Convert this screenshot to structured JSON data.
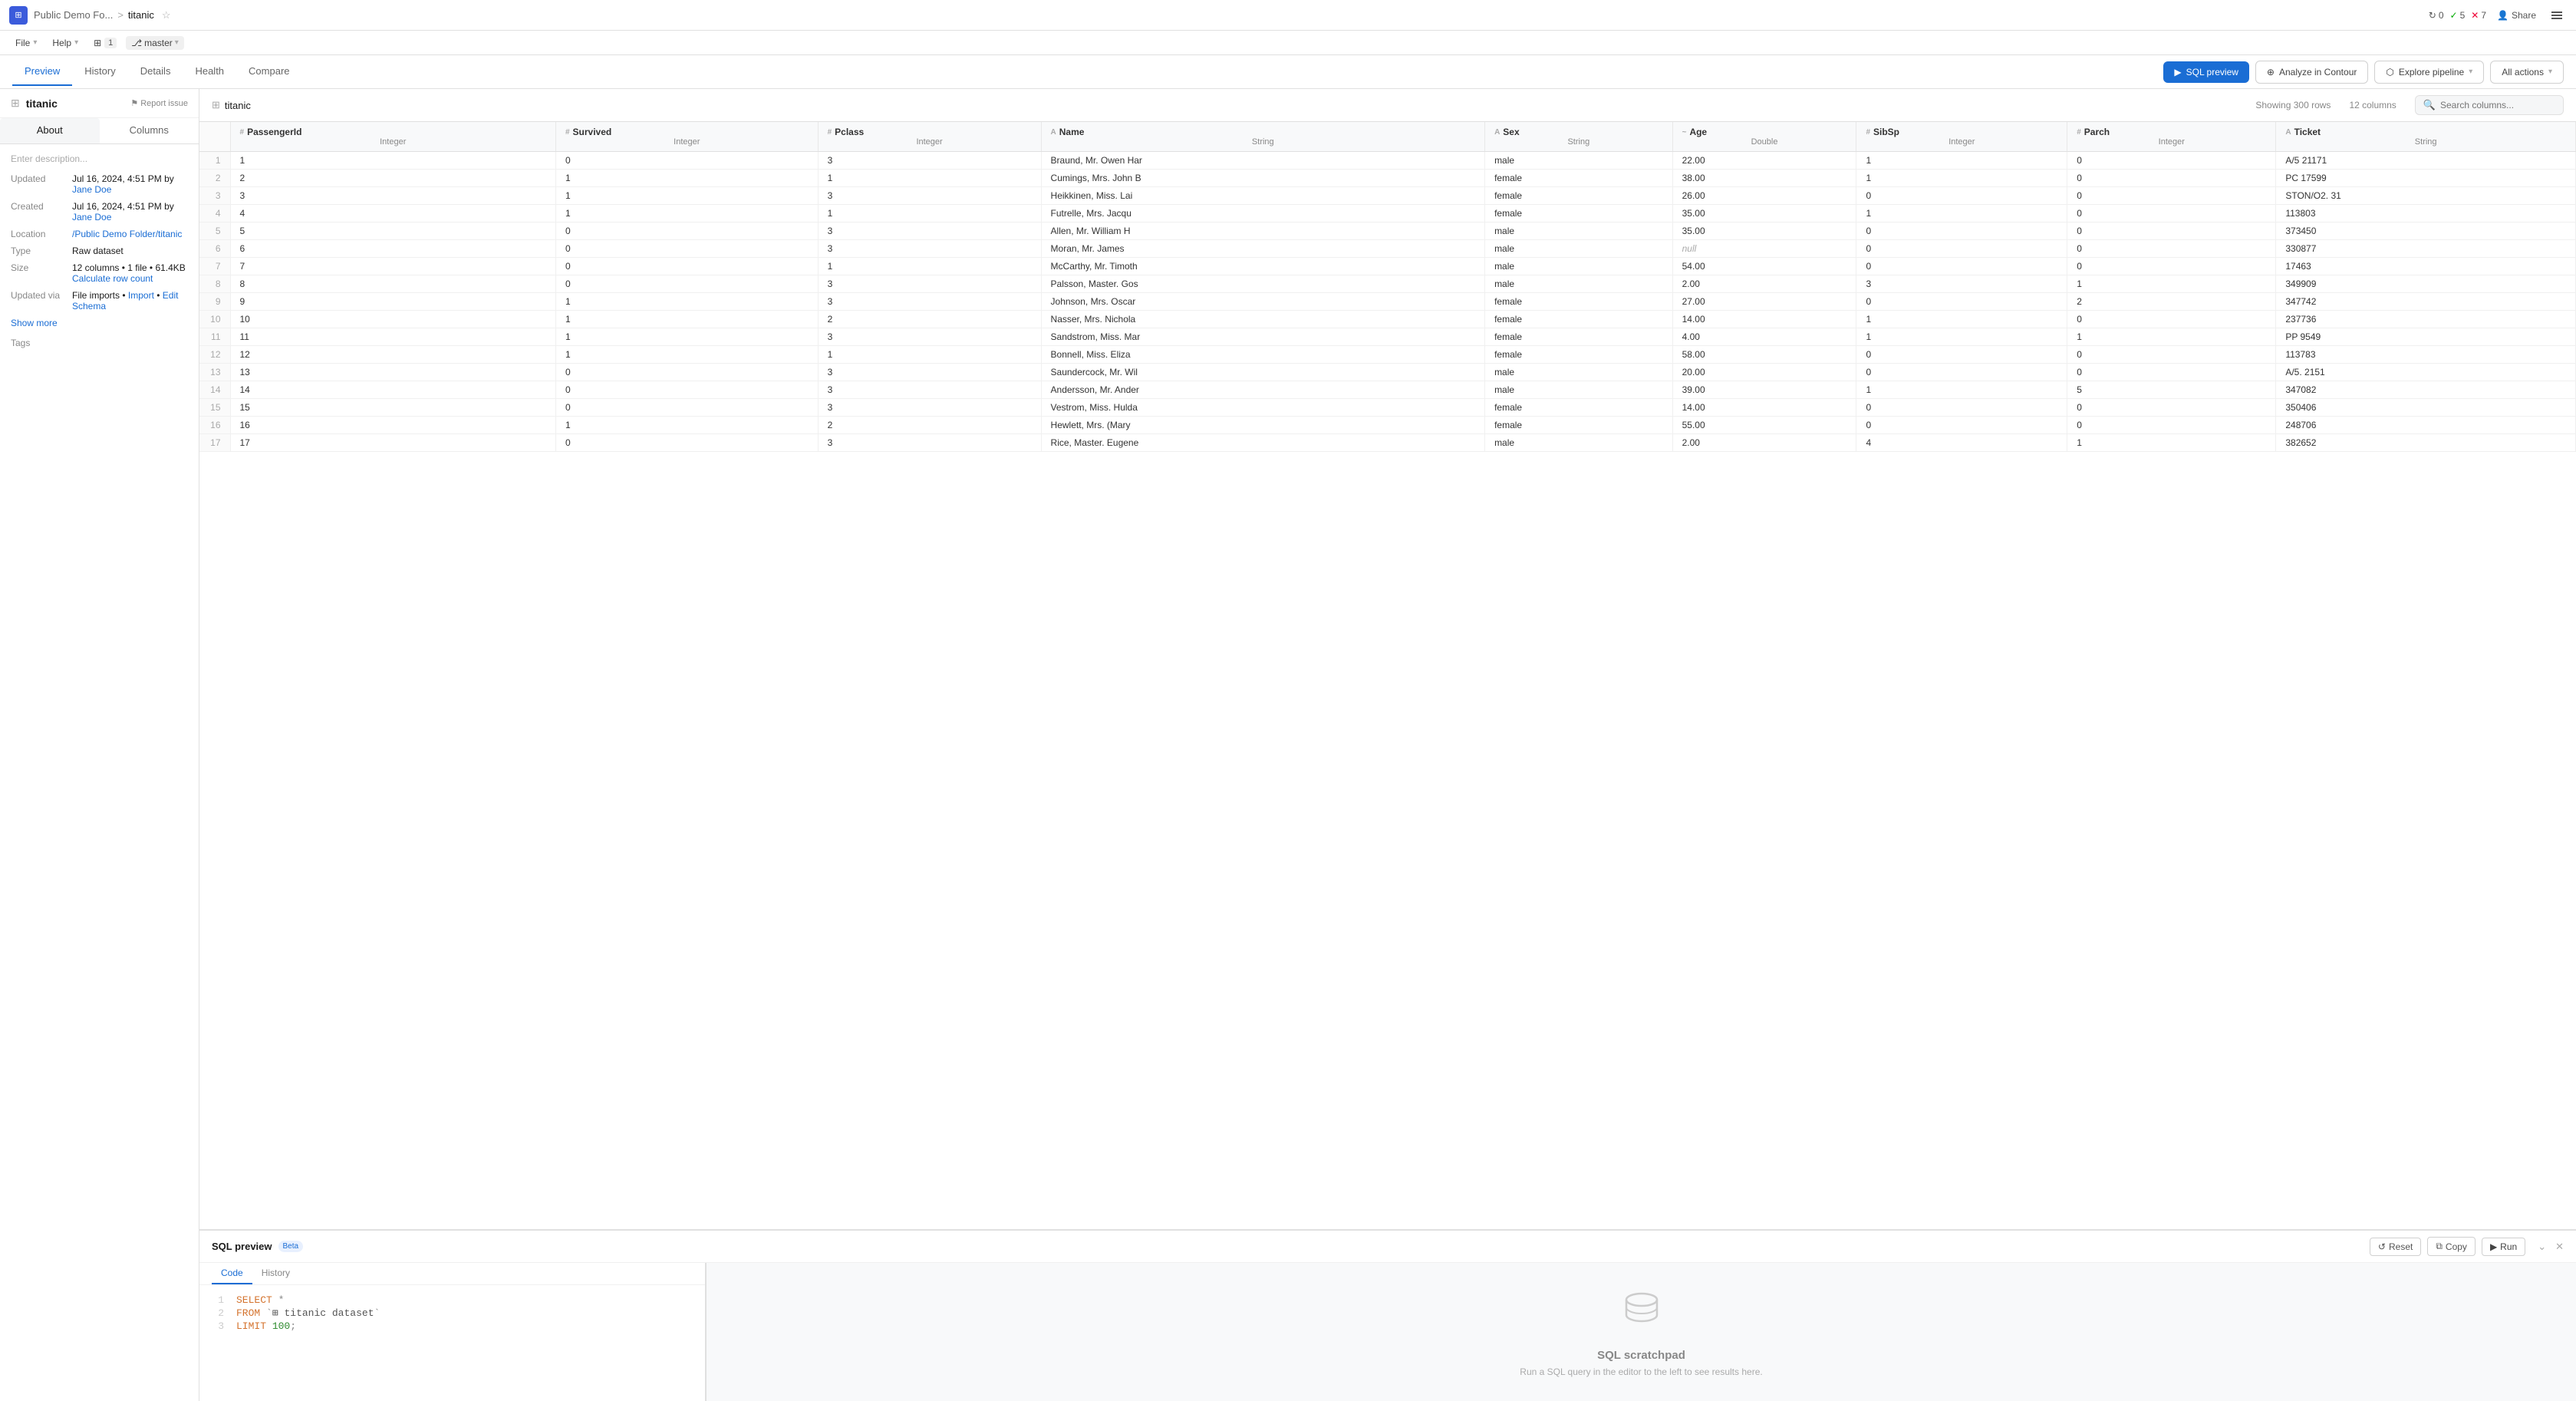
{
  "topbar": {
    "app_icon": "⊞",
    "breadcrumb_parent": "Public Demo Fo...",
    "breadcrumb_sep": ">",
    "breadcrumb_current": "titanic",
    "share_label": "Share",
    "status": {
      "sync_count": "0",
      "check_count": "5",
      "error_count": "7"
    }
  },
  "filemenu": {
    "file_label": "File",
    "help_label": "Help",
    "pages_label": "1",
    "branch_label": "master"
  },
  "tabs": {
    "items": [
      "Preview",
      "History",
      "Details",
      "Health",
      "Compare"
    ],
    "active": "Preview"
  },
  "toolbar": {
    "sql_preview_label": "SQL preview",
    "analyze_label": "Analyze in Contour",
    "explore_label": "Explore pipeline",
    "all_actions_label": "All actions"
  },
  "left_panel": {
    "dataset_name": "titanic",
    "report_issue_label": "Report issue",
    "panel_tabs": [
      "About",
      "Columns"
    ],
    "active_panel_tab": "About",
    "description_placeholder": "Enter description...",
    "meta": {
      "updated_label": "Updated",
      "updated_value": "Jul 16, 2024, 4:51 PM by",
      "updated_user": "Jane Doe",
      "created_label": "Created",
      "created_value": "Jul 16, 2024, 4:51 PM by",
      "created_user": "Jane Doe",
      "location_label": "Location",
      "location_value": "/Public Demo Folder/titanic",
      "type_label": "Type",
      "type_value": "Raw dataset",
      "size_label": "Size",
      "size_value": "12 columns • 1 file • 61.4KB",
      "calculate_label": "Calculate row count",
      "updated_via_label": "Updated via",
      "updated_via_value": "File imports •",
      "import_label": "Import",
      "edit_schema_label": "Edit Schema"
    },
    "show_more_label": "Show more",
    "tags_label": "Tags"
  },
  "data_table": {
    "table_name": "titanic",
    "showing_rows": "Showing 300 rows",
    "columns_count": "12 columns",
    "search_placeholder": "Search columns...",
    "columns": [
      {
        "name": "PassengerId",
        "type": "Integer"
      },
      {
        "name": "Survived",
        "type": "Integer"
      },
      {
        "name": "Pclass",
        "type": "Integer"
      },
      {
        "name": "Name",
        "type": "String"
      },
      {
        "name": "Sex",
        "type": "String"
      },
      {
        "name": "Age",
        "type": "Double"
      },
      {
        "name": "SibSp",
        "type": "Integer"
      },
      {
        "name": "Parch",
        "type": "Integer"
      },
      {
        "name": "Ticket",
        "type": "String"
      }
    ],
    "rows": [
      [
        1,
        0,
        3,
        "Braund, Mr. Owen Har",
        "male",
        "22.00",
        1,
        0,
        "A/5 21171"
      ],
      [
        2,
        1,
        1,
        "Cumings, Mrs. John B",
        "female",
        "38.00",
        1,
        0,
        "PC 17599"
      ],
      [
        3,
        1,
        3,
        "Heikkinen, Miss. Lai",
        "female",
        "26.00",
        0,
        0,
        "STON/O2. 31"
      ],
      [
        4,
        1,
        1,
        "Futrelle, Mrs. Jacqu",
        "female",
        "35.00",
        1,
        0,
        "113803"
      ],
      [
        5,
        0,
        3,
        "Allen, Mr. William H",
        "male",
        "35.00",
        0,
        0,
        "373450"
      ],
      [
        6,
        0,
        3,
        "Moran, Mr. James",
        "male",
        null,
        0,
        0,
        "330877"
      ],
      [
        7,
        0,
        1,
        "McCarthy, Mr. Timoth",
        "male",
        "54.00",
        0,
        0,
        "17463"
      ],
      [
        8,
        0,
        3,
        "Palsson, Master. Gos",
        "male",
        "2.00",
        3,
        1,
        "349909"
      ],
      [
        9,
        1,
        3,
        "Johnson, Mrs. Oscar ",
        "female",
        "27.00",
        0,
        2,
        "347742"
      ],
      [
        10,
        1,
        2,
        "Nasser, Mrs. Nichola",
        "female",
        "14.00",
        1,
        0,
        "237736"
      ],
      [
        11,
        1,
        3,
        "Sandstrom, Miss. Mar",
        "female",
        "4.00",
        1,
        1,
        "PP 9549"
      ],
      [
        12,
        1,
        1,
        "Bonnell, Miss. Eliza",
        "female",
        "58.00",
        0,
        0,
        "113783"
      ],
      [
        13,
        0,
        3,
        "Saundercock, Mr. Wil",
        "male",
        "20.00",
        0,
        0,
        "A/5. 2151"
      ],
      [
        14,
        0,
        3,
        "Andersson, Mr. Ander",
        "male",
        "39.00",
        1,
        5,
        "347082"
      ],
      [
        15,
        0,
        3,
        "Vestrom, Miss. Hulda",
        "female",
        "14.00",
        0,
        0,
        "350406"
      ],
      [
        16,
        1,
        2,
        "Hewlett, Mrs. (Mary ",
        "female",
        "55.00",
        0,
        0,
        "248706"
      ],
      [
        17,
        0,
        3,
        "Rice, Master. Eugene",
        "male",
        "2.00",
        4,
        1,
        "382652"
      ]
    ]
  },
  "sql_panel": {
    "title": "SQL preview",
    "beta_label": "Beta",
    "tabs": [
      "Code",
      "History"
    ],
    "active_tab": "Code",
    "reset_label": "Reset",
    "copy_label": "Copy",
    "run_label": "Run",
    "code_lines": [
      {
        "num": 1,
        "content": "SELECT *"
      },
      {
        "num": 2,
        "content": "FROM `titanic dataset`"
      },
      {
        "num": 3,
        "content": "LIMIT 100;"
      }
    ]
  },
  "scratchpad": {
    "title": "SQL scratchpad",
    "description": "Run a SQL query in the editor to the left to see results here."
  }
}
